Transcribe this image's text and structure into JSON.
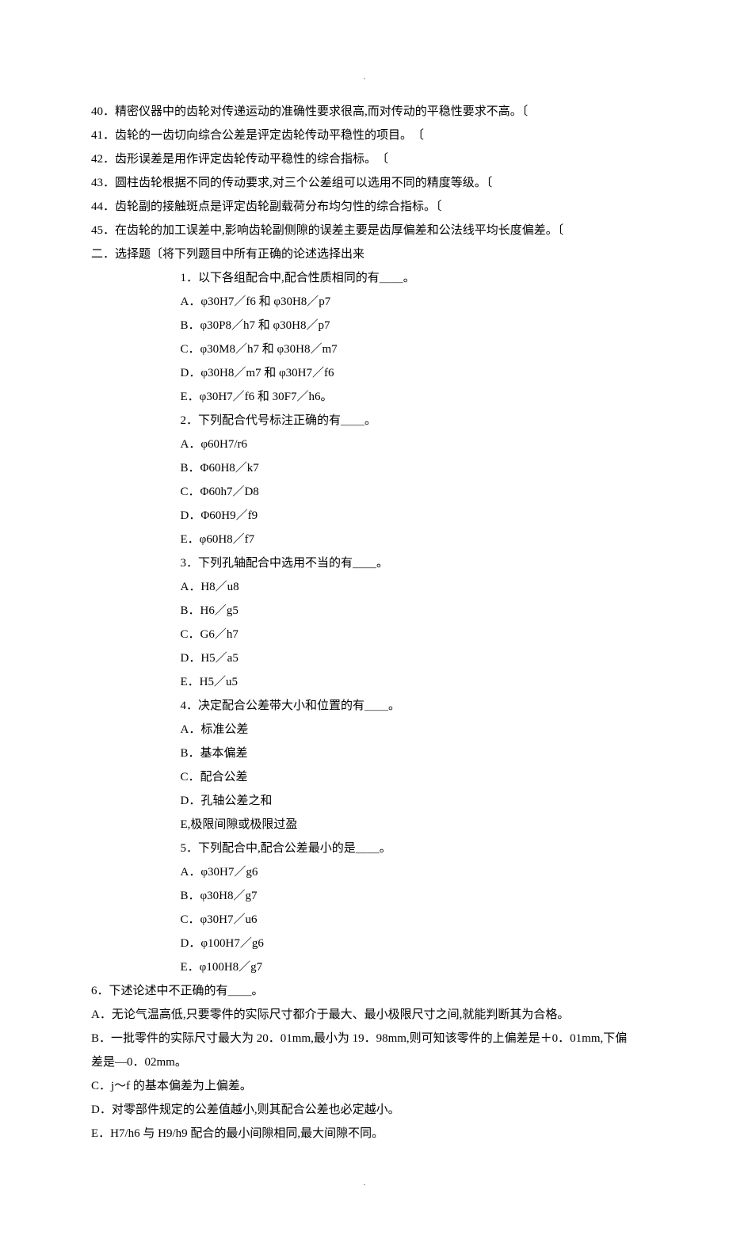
{
  "dot": ".",
  "tf": {
    "q40": "40．精密仪器中的齿轮对传递运动的准确性要求很高,而对传动的平稳性要求不高。〔",
    "q41": "41．齿轮的一齿切向综合公差是评定齿轮传动平稳性的项目。　〔",
    "q42": "42．齿形误差是用作评定齿轮传动平稳性的综合指标。　〔",
    "q43": "43．圆柱齿轮根据不同的传动要求,对三个公差组可以选用不同的精度等级。〔",
    "q44": "44．齿轮副的接触斑点是评定齿轮副载荷分布均匀性的综合指标。〔",
    "q45": "45．在齿轮的加工误差中,影响齿轮副侧隙的误差主要是齿厚偏差和公法线平均长度偏差。〔"
  },
  "mc_header": "二．选择题〔将下列题目中所有正确的论述选择出来",
  "q1": {
    "stem": "1．以下各组配合中,配合性质相同的有＿＿。",
    "A": "A．φ30H7／f6 和 φ30H8／p7",
    "B": "B．φ30P8／h7 和 φ30H8／p7",
    "C": "C．φ30M8／h7 和 φ30H8／m7",
    "D": "D．φ30H8／m7 和 φ30H7／f6",
    "E": "E．φ30H7／f6 和 30F7／h6。"
  },
  "q2": {
    "stem": "2．下列配合代号标注正确的有＿＿。",
    "A": "A．φ60H7/r6",
    "B": "B．Φ60H8／k7",
    "C": "C．Φ60h7／D8",
    "D": "D．Φ60H9／f9",
    "E": "E．φ60H8／f7"
  },
  "q3": {
    "stem": "3．下列孔轴配合中选用不当的有＿＿。",
    "A": "A．H8／u8",
    "B": "B．H6／g5",
    "C": "C．G6／h7",
    "D": "D．H5／a5",
    "E": "E．H5／u5"
  },
  "q4": {
    "stem": "4．决定配合公差带大小和位置的有＿＿。",
    "A": "A．标准公差",
    "B": "B．基本偏差",
    "C": "C．配合公差",
    "D": "D．孔轴公差之和",
    "E": "E,极限间隙或极限过盈"
  },
  "q5": {
    "stem": "5．下列配合中,配合公差最小的是＿＿。",
    "A": "A．φ30H7／g6",
    "B": "B．φ30H8／g7",
    "C": "C．φ30H7／u6",
    "D": "D．φ100H7／g6",
    "E": "E．φ100H8／g7"
  },
  "q6": {
    "stem": "6．下述论述中不正确的有＿＿。",
    "A": "A．无论气温高低,只要零件的实际尺寸都介于最大、最小极限尺寸之间,就能判断其为合格。",
    "B": "B．一批零件的实际尺寸最大为 20．01mm,最小为 19．98mm,则可知该零件的上偏差是＋0．01mm,下偏差是—0．02mm。",
    "C": "C．j～f 的基本偏差为上偏差。",
    "D": "D．对零部件规定的公差值越小,则其配合公差也必定越小。",
    "E": "E．H7/h6 与 H9/h9 配合的最小间隙相同,最大间隙不同。"
  }
}
